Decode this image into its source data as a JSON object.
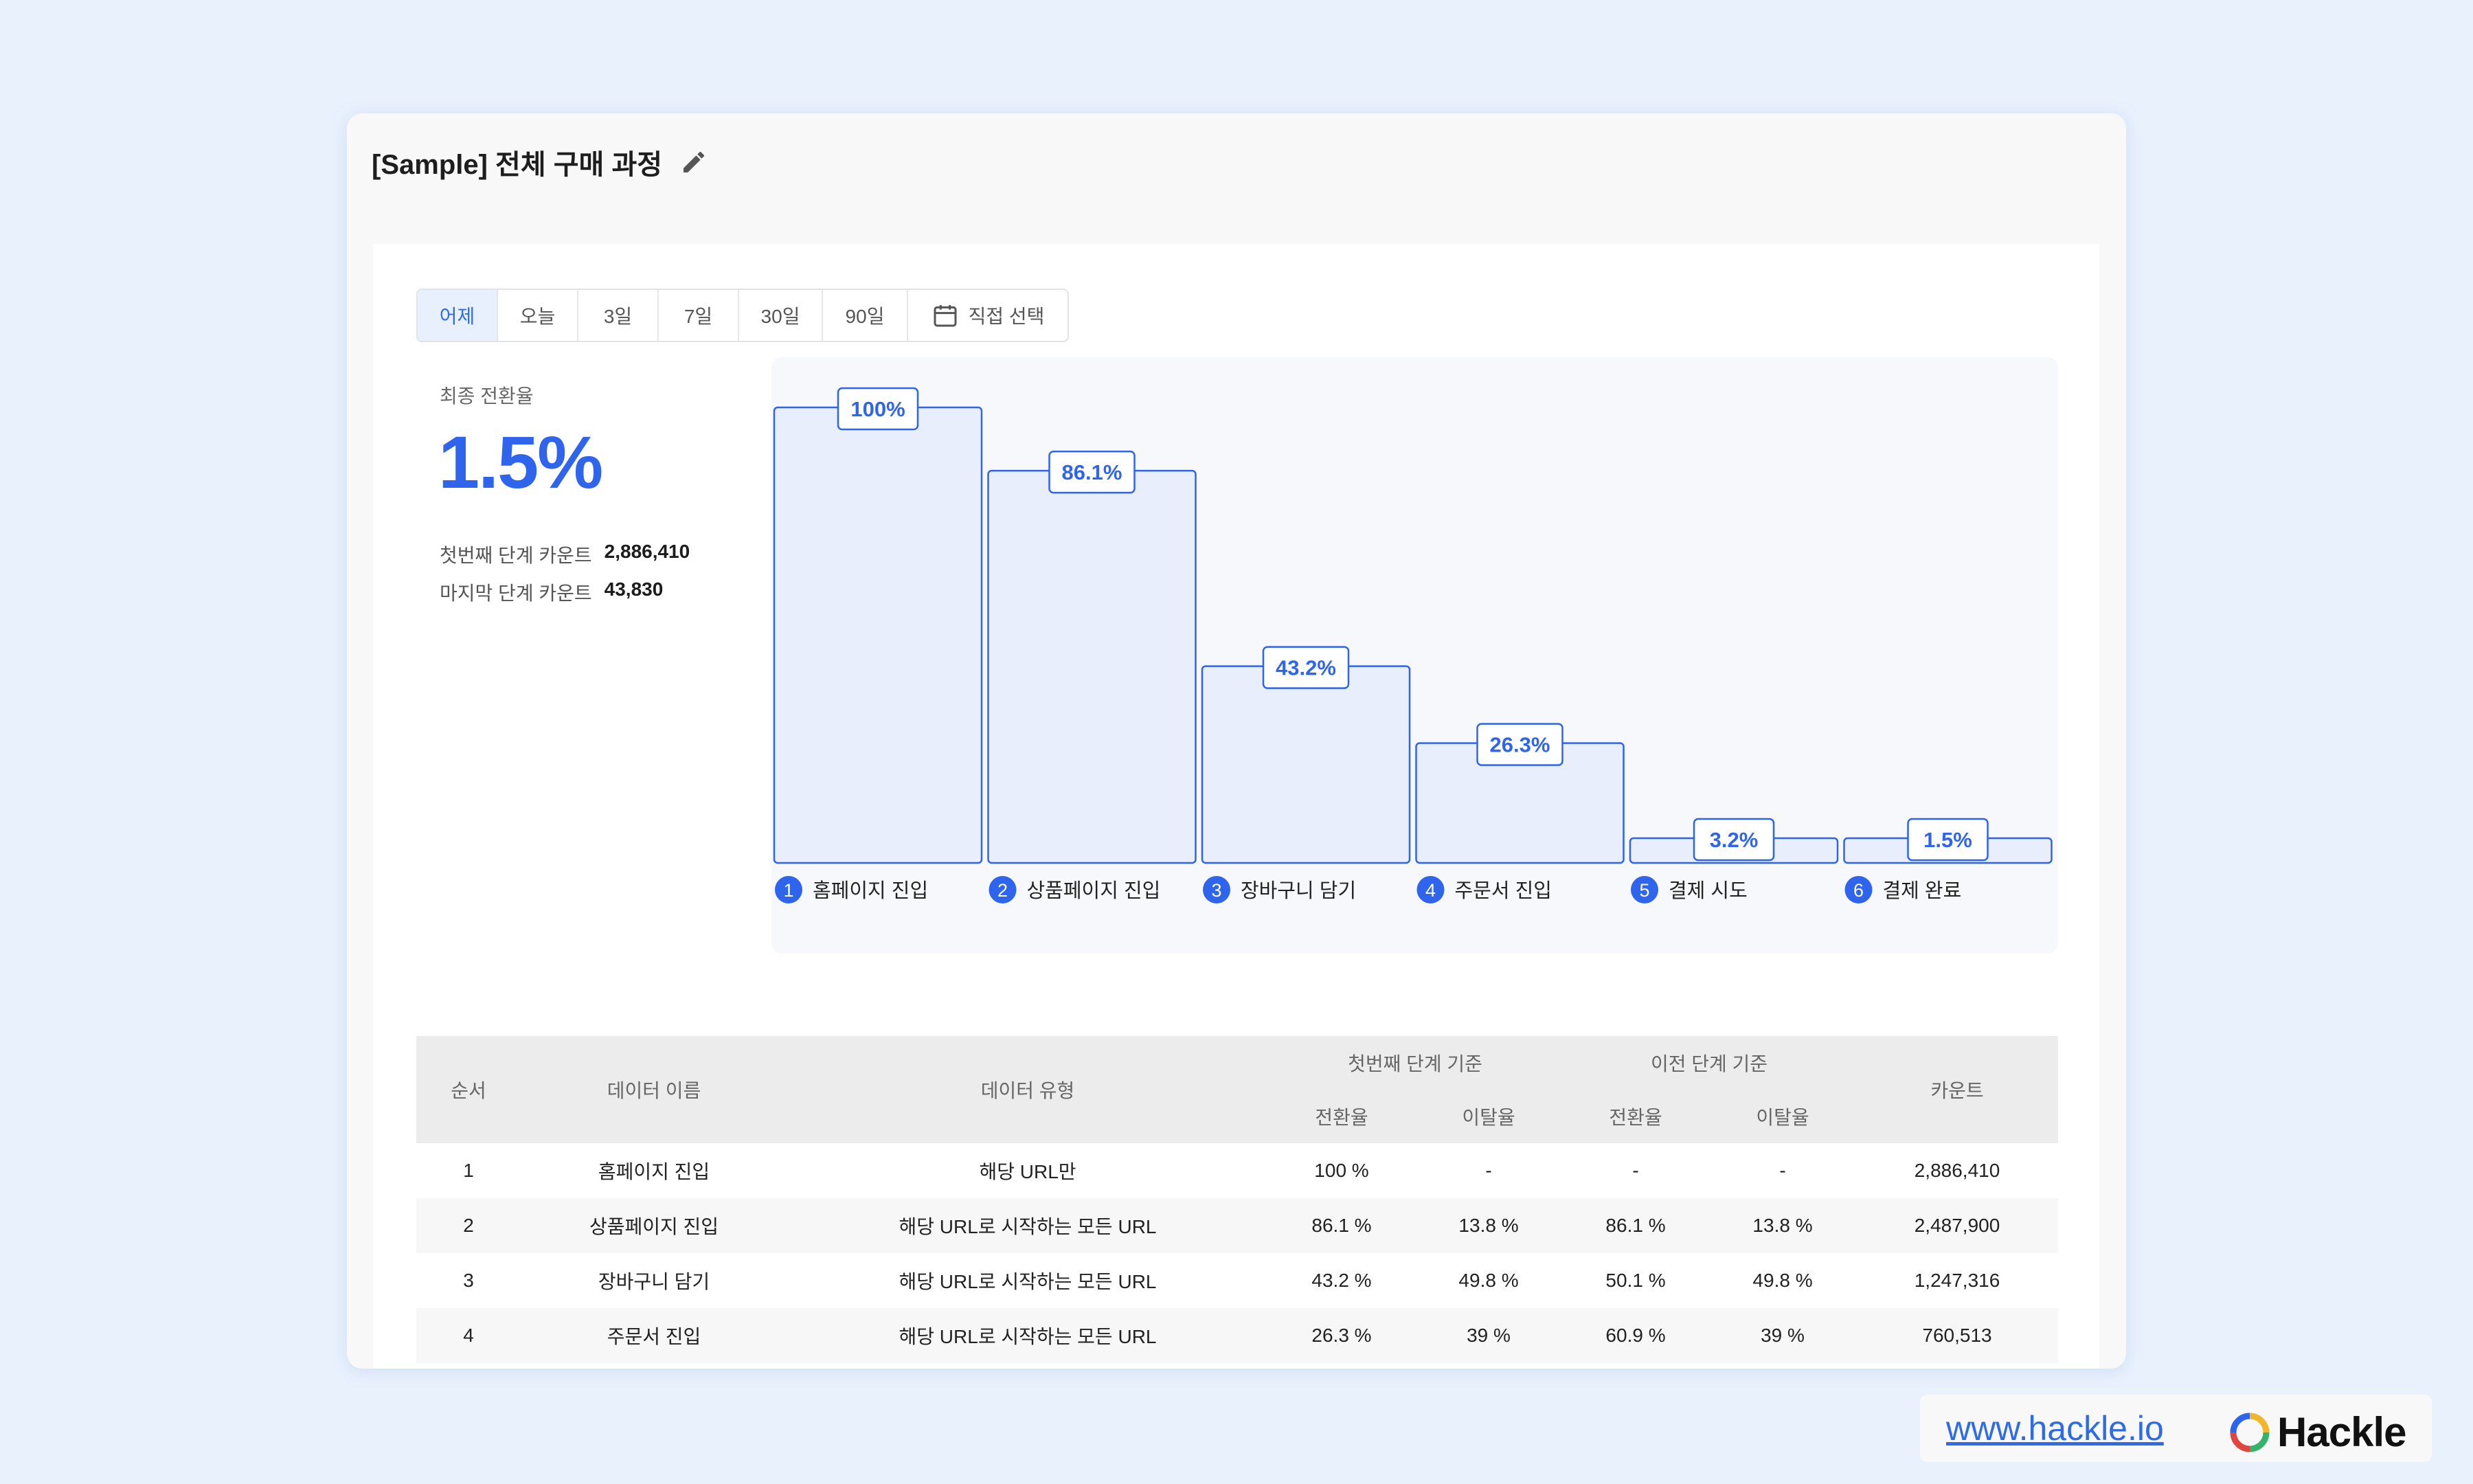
{
  "page": {
    "title": "[Sample] 전체 구매 과정"
  },
  "tabs": [
    {
      "label": "어제",
      "active": true
    },
    {
      "label": "오늘",
      "active": false
    },
    {
      "label": "3일",
      "active": false
    },
    {
      "label": "7일",
      "active": false
    },
    {
      "label": "30일",
      "active": false
    },
    {
      "label": "90일",
      "active": false
    },
    {
      "label": "직접 선택",
      "active": false,
      "icon": "calendar-icon"
    }
  ],
  "summary": {
    "label": "최종 전환율",
    "value": "1.5%",
    "first_label": "첫번째 단계 카운트",
    "first_value": "2,886,410",
    "last_label": "마지막 단계 카운트",
    "last_value": "43,830"
  },
  "chart_data": {
    "type": "bar",
    "categories": [
      "홈페이지 진입",
      "상품페이지 진입",
      "장바구니 담기",
      "주문서 진입",
      "결제 시도",
      "결제 완료"
    ],
    "step_numbers": [
      "1",
      "2",
      "3",
      "4",
      "5",
      "6"
    ],
    "values": [
      100,
      86.1,
      43.2,
      26.3,
      3.2,
      1.5
    ],
    "value_labels": [
      "100%",
      "86.1%",
      "43.2%",
      "26.3%",
      "3.2%",
      "1.5%"
    ],
    "ylim": [
      0,
      100
    ],
    "colors": {
      "bar_fill": "#e8eefb",
      "bar_stroke": "#2f64ec",
      "label": "#2f64ec"
    }
  },
  "table": {
    "headers": {
      "order": "순서",
      "name": "데이터 이름",
      "type": "데이터 유형",
      "first_group": "첫번째 단계 기준",
      "prev_group": "이전 단계 기준",
      "conversion": "전환율",
      "churn": "이탈율",
      "count": "카운트"
    },
    "rows": [
      {
        "order": "1",
        "name": "홈페이지 진입",
        "type": "해당 URL만",
        "first_conv": "100 %",
        "first_churn": "-",
        "prev_conv": "-",
        "prev_churn": "-",
        "count": "2,886,410"
      },
      {
        "order": "2",
        "name": "상품페이지 진입",
        "type": "해당 URL로 시작하는 모든 URL",
        "first_conv": "86.1 %",
        "first_churn": "13.8 %",
        "prev_conv": "86.1 %",
        "prev_churn": "13.8 %",
        "count": "2,487,900"
      },
      {
        "order": "3",
        "name": "장바구니 담기",
        "type": "해당 URL로 시작하는 모든 URL",
        "first_conv": "43.2 %",
        "first_churn": "49.8 %",
        "prev_conv": "50.1 %",
        "prev_churn": "49.8 %",
        "count": "1,247,316"
      },
      {
        "order": "4",
        "name": "주문서 진입",
        "type": "해당 URL로 시작하는 모든 URL",
        "first_conv": "26.3 %",
        "first_churn": "39 %",
        "prev_conv": "60.9 %",
        "prev_churn": "39 %",
        "count": "760,513"
      }
    ]
  },
  "brand": {
    "url": "www.hackle.io",
    "name": "Hackle"
  }
}
